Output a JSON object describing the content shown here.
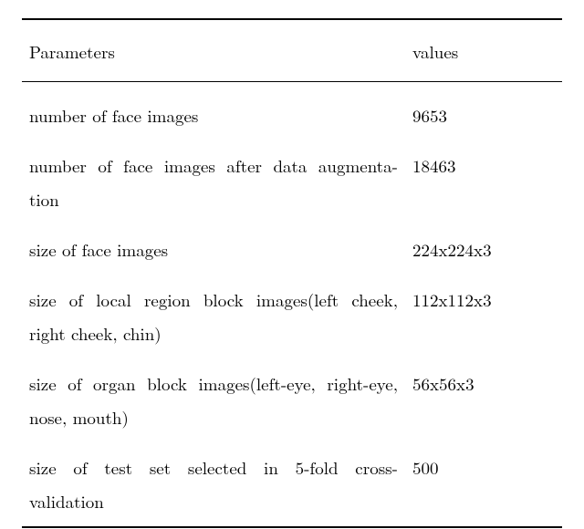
{
  "chart_data": {
    "type": "table",
    "columns": [
      "Parameters",
      "values"
    ],
    "rows": [
      {
        "param": "number of face images",
        "value": "9653"
      },
      {
        "param": "number of face images after data augmentation",
        "value": "18463"
      },
      {
        "param": "size of face images",
        "value": "224x224x3"
      },
      {
        "param": "size of local region block images(left cheek, right cheek, chin)",
        "value": "112x112x3"
      },
      {
        "param": "size of organ block images(left-eye, right-eye, nose, mouth)",
        "value": "56x56x3"
      },
      {
        "param": "size of test set selected in 5-fold cross-validation",
        "value": "500"
      }
    ]
  },
  "header": {
    "col1": "Parameters",
    "col2": "values"
  },
  "rows": {
    "r0": {
      "l1": "number of face images",
      "val": "9653"
    },
    "r1": {
      "l1": "number of face images after data augmenta-",
      "l2": "tion",
      "val": "18463"
    },
    "r2": {
      "l1": "size of face images",
      "val": "224x224x3"
    },
    "r3": {
      "l1": "size of local region block images(left cheek,",
      "l2": "right cheek, chin)",
      "val": "112x112x3"
    },
    "r4": {
      "l1": "size of organ block images(left-eye, right-eye,",
      "l2": "nose, mouth)",
      "val": "56x56x3"
    },
    "r5": {
      "l1": "size of test set selected in 5-fold cross-",
      "l2": "validation",
      "val": "500"
    }
  }
}
